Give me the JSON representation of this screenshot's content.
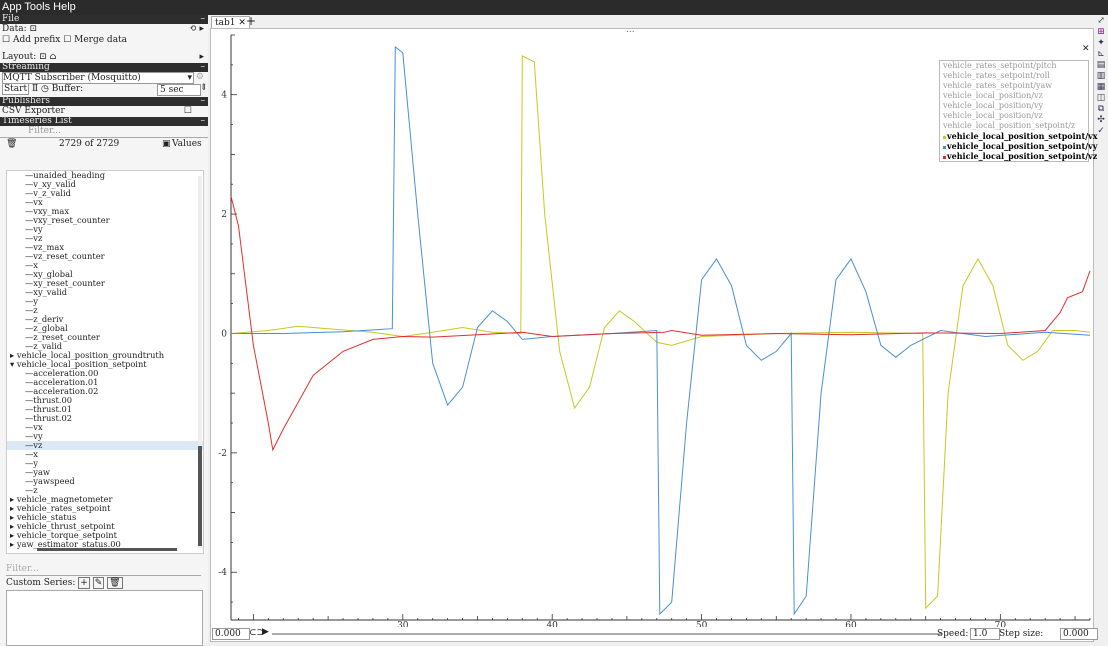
{
  "menubar": {
    "title": "App Tools Help"
  },
  "left": {
    "file_header": "File",
    "data_label": "Data:",
    "add_prefix": "Add prefix",
    "merge_data": "Merge data",
    "layout_label": "Layout:",
    "streaming_header": "Streaming",
    "streaming_source": "MQTT Subscriber (Mosquitto)",
    "start_button": "Start",
    "buffer_label": "Buffer:",
    "buffer_value": "5 sec",
    "publishers_header": "Publishers",
    "csv_exporter": "CSV Exporter",
    "timeseries_header": "Timeseries List",
    "filter_placeholder": "Filter...",
    "count_text": "2729 of 2729",
    "values_label": "Values",
    "tree_items": [
      {
        "label": "unaided_heading",
        "indent": 2
      },
      {
        "label": "v_xy_valid",
        "indent": 2
      },
      {
        "label": "v_z_valid",
        "indent": 2
      },
      {
        "label": "vx",
        "indent": 2
      },
      {
        "label": "vxy_max",
        "indent": 2
      },
      {
        "label": "vxy_reset_counter",
        "indent": 2
      },
      {
        "label": "vy",
        "indent": 2
      },
      {
        "label": "vz",
        "indent": 2
      },
      {
        "label": "vz_max",
        "indent": 2
      },
      {
        "label": "vz_reset_counter",
        "indent": 2
      },
      {
        "label": "x",
        "indent": 2
      },
      {
        "label": "xy_global",
        "indent": 2
      },
      {
        "label": "xy_reset_counter",
        "indent": 2
      },
      {
        "label": "xy_valid",
        "indent": 2
      },
      {
        "label": "y",
        "indent": 2
      },
      {
        "label": "z",
        "indent": 2
      },
      {
        "label": "z_deriv",
        "indent": 2
      },
      {
        "label": "z_global",
        "indent": 2
      },
      {
        "label": "z_reset_counter",
        "indent": 2
      },
      {
        "label": "z_valid",
        "indent": 2
      },
      {
        "label": "vehicle_local_position_groundtruth",
        "indent": 1,
        "arrow": "▸"
      },
      {
        "label": "vehicle_local_position_setpoint",
        "indent": 1,
        "arrow": "▾"
      },
      {
        "label": "acceleration.00",
        "indent": 2
      },
      {
        "label": "acceleration.01",
        "indent": 2
      },
      {
        "label": "acceleration.02",
        "indent": 2
      },
      {
        "label": "thrust.00",
        "indent": 2
      },
      {
        "label": "thrust.01",
        "indent": 2
      },
      {
        "label": "thrust.02",
        "indent": 2
      },
      {
        "label": "vx",
        "indent": 2
      },
      {
        "label": "vy",
        "indent": 2
      },
      {
        "label": "vz",
        "indent": 2,
        "selected": true
      },
      {
        "label": "x",
        "indent": 2
      },
      {
        "label": "y",
        "indent": 2
      },
      {
        "label": "yaw",
        "indent": 2
      },
      {
        "label": "yawspeed",
        "indent": 2
      },
      {
        "label": "z",
        "indent": 2
      },
      {
        "label": "vehicle_magnetometer",
        "indent": 1,
        "arrow": "▸"
      },
      {
        "label": "vehicle_rates_setpoint",
        "indent": 1,
        "arrow": "▸"
      },
      {
        "label": "vehicle_status",
        "indent": 1,
        "arrow": "▸"
      },
      {
        "label": "vehicle_thrust_setpoint",
        "indent": 1,
        "arrow": "▸"
      },
      {
        "label": "vehicle_torque_setpoint",
        "indent": 1,
        "arrow": "▸"
      },
      {
        "label": "yaw_estimator_status.00",
        "indent": 1,
        "arrow": "▸"
      }
    ],
    "filter2_placeholder": "Filter...",
    "custom_series_label": "Custom Series:"
  },
  "tab": {
    "label": "tab1",
    "dots": "..."
  },
  "legend": [
    {
      "label": "vehicle_rates_setpoint/pitch",
      "active": false
    },
    {
      "label": "vehicle_rates_setpoint/roll",
      "active": false
    },
    {
      "label": "vehicle_rates_setpoint/yaw",
      "active": false
    },
    {
      "label": "vehicle_local_position/vz",
      "active": false
    },
    {
      "label": "vehicle_local_position/vy",
      "active": false
    },
    {
      "label": "vehicle_local_position/vz",
      "active": false
    },
    {
      "label": "vehicle_local_position_setpoint/z",
      "active": false
    },
    {
      "label": "vehicle_local_position_setpoint/vx",
      "active": true,
      "color": "#c8c820"
    },
    {
      "label": "vehicle_local_position_setpoint/vy",
      "active": true,
      "color": "#4a8fd4"
    },
    {
      "label": "vehicle_local_position_setpoint/vz",
      "active": true,
      "color": "#e0302a"
    }
  ],
  "bottom": {
    "time_value": "0.000",
    "speed_label": "Speed:",
    "speed_value": "1.0",
    "step_label": "Step size:",
    "step_value": "0.000"
  },
  "chart_data": {
    "type": "line",
    "xlim": [
      18.5,
      76
    ],
    "ylim": [
      -4.8,
      5.0
    ],
    "xticks": [
      30,
      40,
      50,
      60,
      70
    ],
    "yticks": [
      -4,
      -2,
      0,
      2,
      4
    ],
    "grid": false,
    "legend_position": "top-right",
    "series": [
      {
        "name": "vehicle_local_position_setpoint/vx",
        "color": "#c8c820",
        "points": [
          [
            18.5,
            0
          ],
          [
            21,
            0.05
          ],
          [
            23,
            0.12
          ],
          [
            25,
            0.08
          ],
          [
            28,
            0.02
          ],
          [
            30,
            -0.05
          ],
          [
            32,
            0.02
          ],
          [
            34,
            0.1
          ],
          [
            36,
            0.02
          ],
          [
            37.9,
            0
          ],
          [
            38,
            4.65
          ],
          [
            38.8,
            4.55
          ],
          [
            39.5,
            2.0
          ],
          [
            40.5,
            -0.3
          ],
          [
            41.5,
            -1.25
          ],
          [
            42.5,
            -0.9
          ],
          [
            43.5,
            0.1
          ],
          [
            44.5,
            0.38
          ],
          [
            45.5,
            0.2
          ],
          [
            47,
            -0.15
          ],
          [
            48,
            -0.2
          ],
          [
            50,
            -0.05
          ],
          [
            55,
            0
          ],
          [
            60,
            0.02
          ],
          [
            64.8,
            0
          ],
          [
            65,
            -4.6
          ],
          [
            65.8,
            -4.4
          ],
          [
            66.5,
            -1.0
          ],
          [
            67.5,
            0.8
          ],
          [
            68.5,
            1.25
          ],
          [
            69.5,
            0.8
          ],
          [
            70.5,
            -0.2
          ],
          [
            71.5,
            -0.45
          ],
          [
            72.5,
            -0.3
          ],
          [
            73.5,
            0.05
          ],
          [
            75,
            0.05
          ],
          [
            76,
            0.02
          ]
        ]
      },
      {
        "name": "vehicle_local_position_setpoint/vy",
        "color": "#4a8fd4",
        "points": [
          [
            18.5,
            0
          ],
          [
            22,
            0
          ],
          [
            26,
            0.03
          ],
          [
            29.3,
            0.08
          ],
          [
            29.5,
            4.8
          ],
          [
            30,
            4.7
          ],
          [
            31,
            2.0
          ],
          [
            32,
            -0.5
          ],
          [
            33,
            -1.2
          ],
          [
            34,
            -0.9
          ],
          [
            35,
            0.1
          ],
          [
            36,
            0.38
          ],
          [
            37,
            0.2
          ],
          [
            38,
            -0.1
          ],
          [
            40,
            -0.05
          ],
          [
            44,
            0
          ],
          [
            47,
            0.05
          ],
          [
            47.2,
            -4.7
          ],
          [
            48,
            -4.5
          ],
          [
            49,
            -1.5
          ],
          [
            50,
            0.9
          ],
          [
            51,
            1.25
          ],
          [
            52,
            0.8
          ],
          [
            53,
            -0.2
          ],
          [
            54,
            -0.45
          ],
          [
            55,
            -0.3
          ],
          [
            56,
            0
          ],
          [
            56.2,
            -4.7
          ],
          [
            57,
            -4.4
          ],
          [
            58,
            -1.0
          ],
          [
            59,
            0.9
          ],
          [
            60,
            1.25
          ],
          [
            61,
            0.7
          ],
          [
            62,
            -0.2
          ],
          [
            63,
            -0.4
          ],
          [
            64,
            -0.2
          ],
          [
            66,
            0.05
          ],
          [
            69,
            -0.05
          ],
          [
            73,
            0.02
          ],
          [
            76,
            -0.03
          ]
        ]
      },
      {
        "name": "vehicle_local_position_setpoint/vz",
        "color": "#e0302a",
        "points": [
          [
            18.5,
            2.3
          ],
          [
            19,
            1.8
          ],
          [
            20,
            -0.2
          ],
          [
            21,
            -1.5
          ],
          [
            21.3,
            -1.95
          ],
          [
            22,
            -1.6
          ],
          [
            24,
            -0.7
          ],
          [
            26,
            -0.3
          ],
          [
            28,
            -0.1
          ],
          [
            30,
            -0.05
          ],
          [
            32,
            -0.06
          ],
          [
            35,
            -0.02
          ],
          [
            38,
            0.02
          ],
          [
            40,
            -0.05
          ],
          [
            44,
            0
          ],
          [
            47.5,
            0.02
          ],
          [
            48,
            0.05
          ],
          [
            50,
            -0.03
          ],
          [
            55,
            0
          ],
          [
            60,
            -0.02
          ],
          [
            65,
            0.01
          ],
          [
            70,
            0
          ],
          [
            73,
            0.05
          ],
          [
            74,
            0.35
          ],
          [
            74.5,
            0.6
          ],
          [
            75.5,
            0.7
          ],
          [
            76,
            1.05
          ]
        ]
      }
    ]
  }
}
